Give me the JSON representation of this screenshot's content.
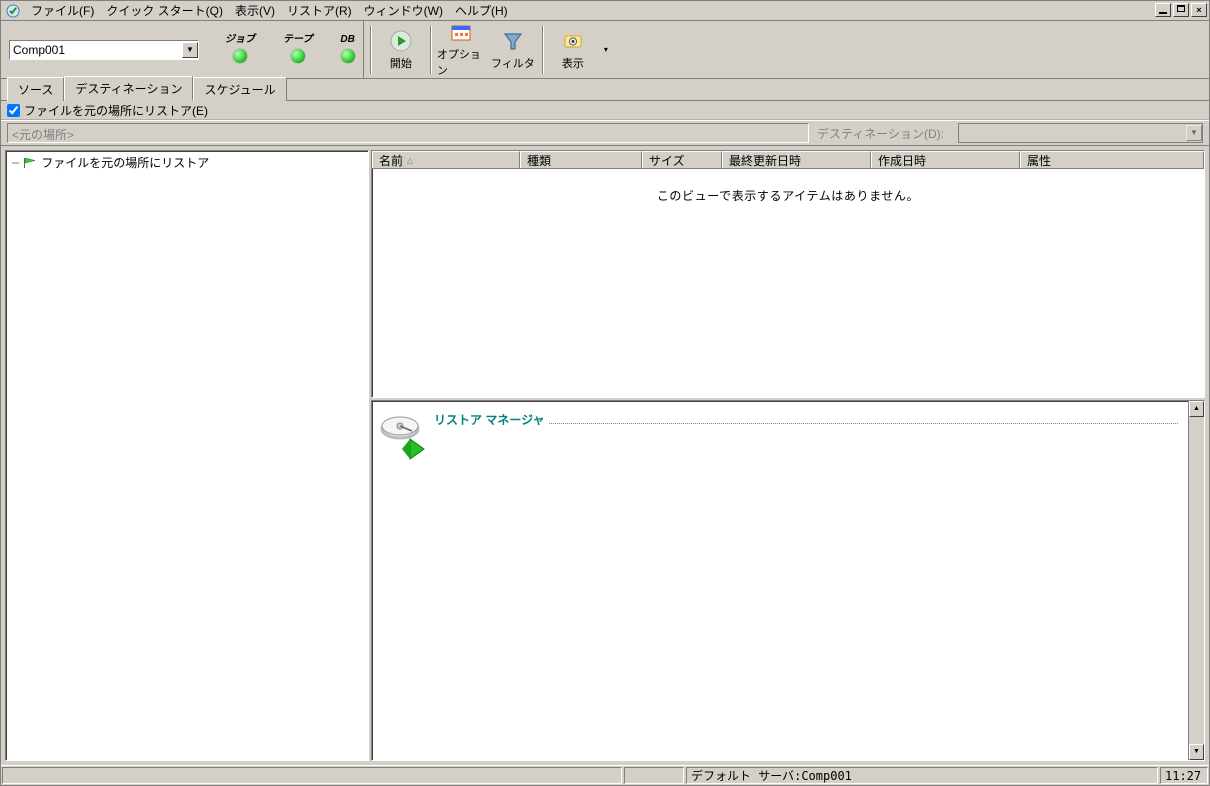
{
  "menu": {
    "file": "ファイル(F)",
    "quickstart": "クイック スタート(Q)",
    "view": "表示(V)",
    "restore": "リストア(R)",
    "window": "ウィンドウ(W)",
    "help": "ヘルプ(H)"
  },
  "server_combo": "Comp001",
  "lights": {
    "job": "ジョブ",
    "tape": "テープ",
    "db": "DB"
  },
  "toolbar": {
    "start": "開始",
    "option": "オプション",
    "filter": "フィルタ",
    "display": "表示"
  },
  "tabs": {
    "source": "ソース",
    "destination": "デスティネーション",
    "schedule": "スケジュール"
  },
  "checkbox_label": "ファイルを元の場所にリストア(E)",
  "dest_bar": {
    "readonly_text": "<元の場所>",
    "dest_label": "デスティネーション(D):"
  },
  "tree": {
    "root": "ファイルを元の場所にリストア"
  },
  "list": {
    "cols": {
      "name": "名前",
      "type": "種類",
      "size": "サイズ",
      "modified": "最終更新日時",
      "created": "作成日時",
      "attrs": "属性"
    },
    "empty": "このビューで表示するアイテムはありません。"
  },
  "lower": {
    "title": "リストア マネージャ"
  },
  "status": {
    "server": "デフォルト サーバ:Comp001",
    "time": "11:27"
  }
}
